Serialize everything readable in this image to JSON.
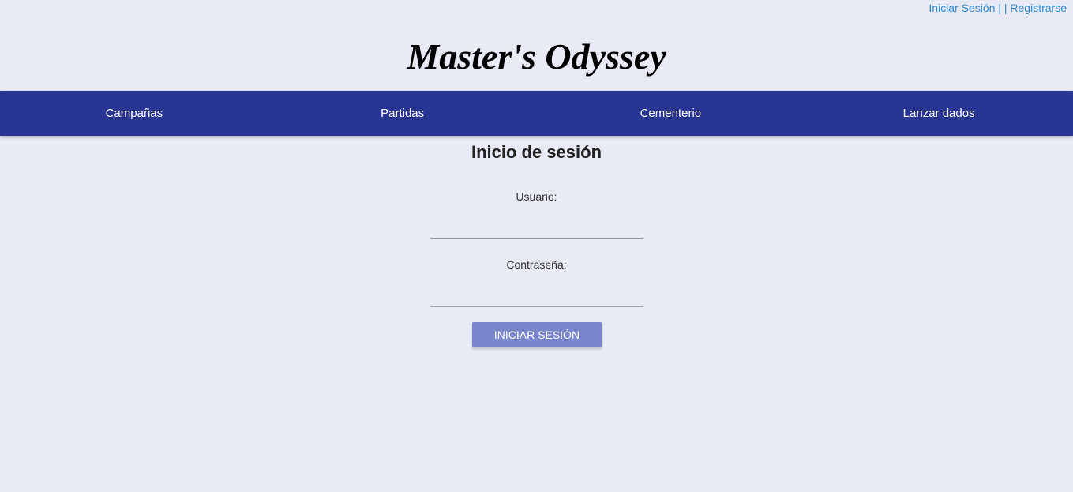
{
  "header": {
    "login_link": "Iniciar Sesión",
    "separator": " | | ",
    "register_link": "Registrarse",
    "site_title": "Master's Odyssey"
  },
  "nav": {
    "items": [
      {
        "label": "Campañas"
      },
      {
        "label": "Partidas"
      },
      {
        "label": "Cementerio"
      },
      {
        "label": "Lanzar dados"
      }
    ]
  },
  "login_form": {
    "title": "Inicio de sesión",
    "username_label": "Usuario:",
    "username_value": "",
    "password_label": "Contraseña:",
    "password_value": "",
    "submit_label": "INICIAR SESIÓN"
  },
  "colors": {
    "background": "#e8eaf6",
    "navbar": "#283593",
    "button": "#7986cb",
    "link": "#2e8bd4"
  }
}
